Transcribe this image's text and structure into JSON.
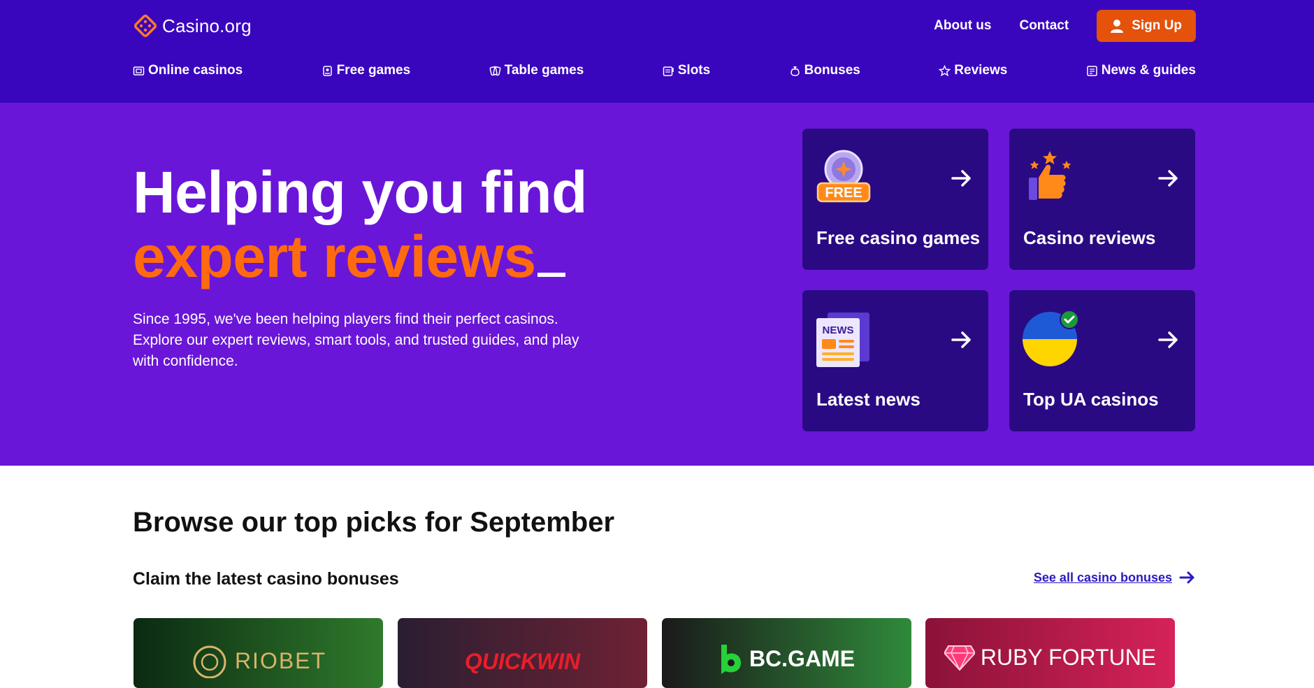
{
  "header": {
    "logo_text": "Casino.org",
    "links": {
      "about": "About us",
      "contact": "Contact"
    },
    "signup_label": "Sign Up"
  },
  "nav": [
    {
      "label": "Online casinos",
      "icon": "casino-icon"
    },
    {
      "label": "Free games",
      "icon": "free-games-icon"
    },
    {
      "label": "Table games",
      "icon": "table-games-icon"
    },
    {
      "label": "Slots",
      "icon": "slots-icon"
    },
    {
      "label": "Bonuses",
      "icon": "bonus-bag-icon"
    },
    {
      "label": "Reviews",
      "icon": "star-icon"
    },
    {
      "label": "News & guides",
      "icon": "newspaper-icon"
    }
  ],
  "hero": {
    "title_line1": "Helping you find",
    "title_line2": "expert reviews",
    "description": "Since 1995, we've been helping players find their perfect casinos. Explore our expert reviews, smart tools, and trusted guides, and play with confidence."
  },
  "tiles": [
    {
      "label": "Free casino games",
      "icon": "free-chip-icon"
    },
    {
      "label": "Casino reviews",
      "icon": "thumbs-up-stars-icon"
    },
    {
      "label": "Latest news",
      "icon": "news-icon",
      "badge": "NEWS"
    },
    {
      "label": "Top UA casinos",
      "icon": "ukraine-flag-check-icon"
    }
  ],
  "picks": {
    "title": "Browse our top picks for September",
    "subtitle": "Claim the latest casino bonuses",
    "see_all": "See all casino bonuses"
  },
  "brands": [
    {
      "name": "RIOBET"
    },
    {
      "name": "QUICKWIN"
    },
    {
      "name": "BC.GAME"
    },
    {
      "name": "RUBY FORTUNE"
    }
  ],
  "colors": {
    "header_bg": "#3a06bd",
    "hero_bg": "#6a16d8",
    "tile_bg": "#2a0a82",
    "accent_orange": "#ff6a10",
    "signup_bg": "#e4520c",
    "link_blue": "#2b1ac0"
  }
}
